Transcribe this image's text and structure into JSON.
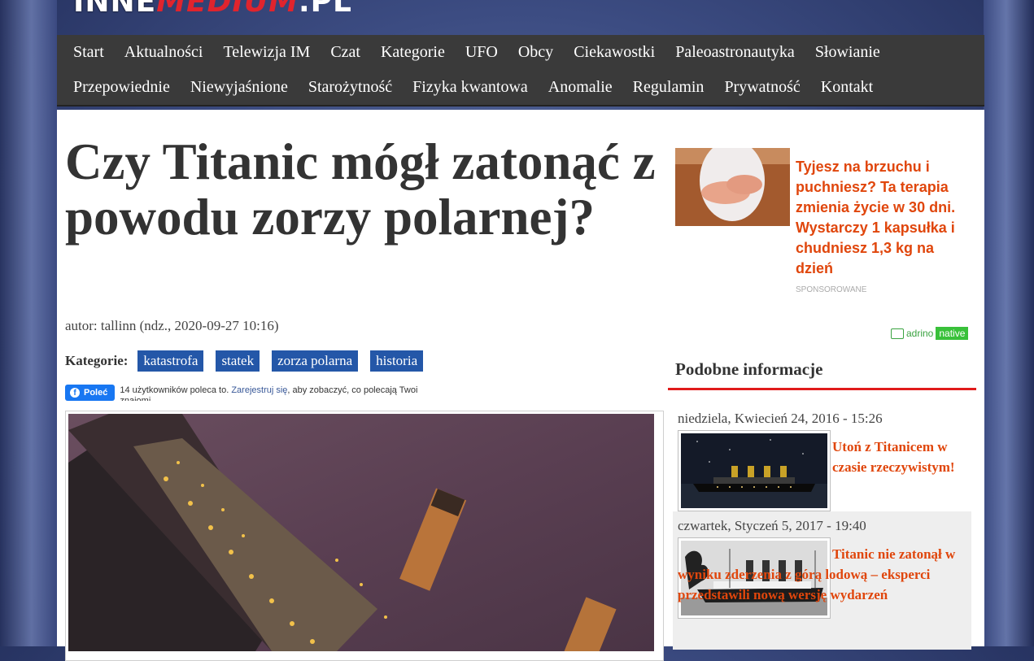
{
  "site": {
    "logo_part1": "INNE",
    "logo_part2": "MEDIUM",
    "logo_part3": ".PL"
  },
  "nav": {
    "items": [
      {
        "label": "Start"
      },
      {
        "label": "Aktualności"
      },
      {
        "label": "Telewizja IM"
      },
      {
        "label": "Czat"
      },
      {
        "label": "Kategorie"
      },
      {
        "label": "UFO"
      },
      {
        "label": "Obcy"
      },
      {
        "label": "Ciekawostki"
      },
      {
        "label": "Paleoastronautyka"
      },
      {
        "label": "Słowianie"
      },
      {
        "label": "Przepowiednie"
      },
      {
        "label": "Niewyjaśnione"
      },
      {
        "label": "Starożytność"
      },
      {
        "label": "Fizyka kwantowa"
      },
      {
        "label": "Anomalie"
      },
      {
        "label": "Regulamin"
      },
      {
        "label": "Prywatność"
      },
      {
        "label": "Kontakt"
      }
    ]
  },
  "article": {
    "title": "Czy Titanic mógł zatonąć z powodu zorzy polarnej?",
    "meta": "autor: tallinn (ndz., 2020-09-27 10:16)",
    "categories_label": "Kategorie:",
    "tags": [
      "katastrofa",
      "statek",
      "zorza polarna",
      "historia"
    ]
  },
  "facebook": {
    "button_label": "Poleć",
    "text_before": "14 użytkowników poleca to. ",
    "link": "Zarejestruj się",
    "text_after": ", aby zobaczyć, co polecają Twoi znajomi."
  },
  "sponsored": {
    "title": "Tyjesz na brzuchu i puchniesz? Ta terapia zmienia życie w 30 dni. Wystarczy 1 kapsułka i chudniesz 1,3 kg na dzień",
    "label": "SPONSOROWANE",
    "network_a": "adrino",
    "network_b": "native"
  },
  "similar": {
    "heading": "Podobne informacje",
    "items": [
      {
        "date": "niedziela, Kwiecień 24, 2016 - 15:26",
        "title": "Utoń z Titanicem w czasie rzeczywistym!"
      },
      {
        "date": "czwartek, Styczeń 5, 2017 - 19:40",
        "title": "Titanic nie zatonął w wyniku zderzenia z górą lodową – eksperci przedstawili nową wersję wydarzeń"
      }
    ]
  },
  "colors": {
    "nav_bg": "#3a3a3a",
    "tag_bg": "#2457a8",
    "link_orange": "#e0460c",
    "rule_red": "#e01b1b"
  }
}
